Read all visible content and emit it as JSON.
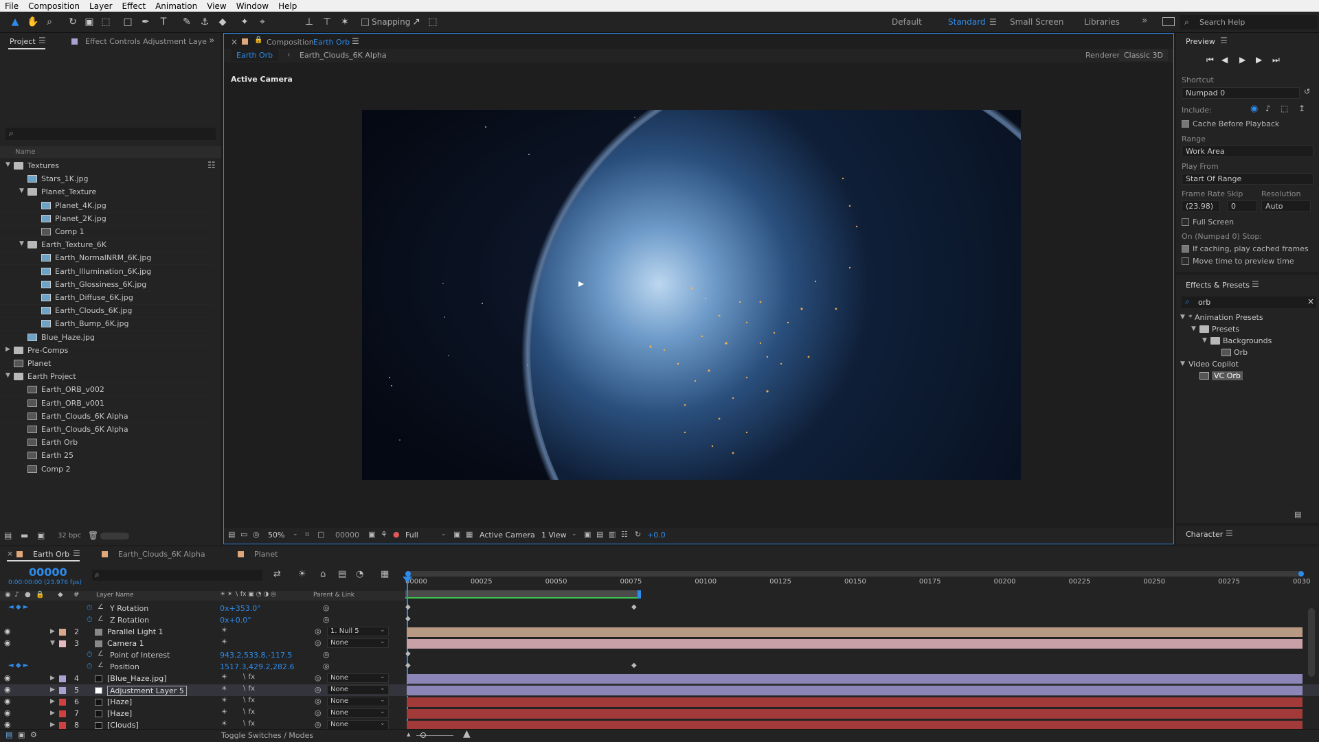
{
  "menu": [
    "File",
    "Composition",
    "Layer",
    "Effect",
    "Animation",
    "View",
    "Window",
    "Help"
  ],
  "toolbar": {
    "snapping": "Snapping"
  },
  "workspaces": {
    "default": "Default",
    "standard": "Standard",
    "small": "Small Screen",
    "libraries": "Libraries",
    "search": "Search Help"
  },
  "project": {
    "tab_label": "Project",
    "effects_tab": "Effect Controls Adjustment Laye",
    "col_name": "Name",
    "bpc": "32 bpc",
    "items": [
      {
        "label": "Textures",
        "type": "folder",
        "level": 0,
        "open": true
      },
      {
        "label": "Stars_1K.jpg",
        "type": "img",
        "level": 1
      },
      {
        "label": "Planet_Texture",
        "type": "folder",
        "level": 1,
        "open": true
      },
      {
        "label": "Planet_4K.jpg",
        "type": "img",
        "level": 2
      },
      {
        "label": "Planet_2K.jpg",
        "type": "img",
        "level": 2
      },
      {
        "label": "Comp 1",
        "type": "comp",
        "level": 2
      },
      {
        "label": "Earth_Texture_6K",
        "type": "folder",
        "level": 1,
        "open": true
      },
      {
        "label": "Earth_NormalNRM_6K.jpg",
        "type": "img",
        "level": 2
      },
      {
        "label": "Earth_Illumination_6K.jpg",
        "type": "img",
        "level": 2
      },
      {
        "label": "Earth_Glossiness_6K.jpg",
        "type": "img",
        "level": 2
      },
      {
        "label": "Earth_Diffuse_6K.jpg",
        "type": "img",
        "level": 2
      },
      {
        "label": "Earth_Clouds_6K.jpg",
        "type": "img",
        "level": 2
      },
      {
        "label": "Earth_Bump_6K.jpg",
        "type": "img",
        "level": 2
      },
      {
        "label": "Blue_Haze.jpg",
        "type": "img",
        "level": 1
      },
      {
        "label": "Pre-Comps",
        "type": "folder",
        "level": 0,
        "open": false
      },
      {
        "label": "Planet",
        "type": "comp",
        "level": 0
      },
      {
        "label": "Earth Project",
        "type": "folder",
        "level": 0,
        "open": true
      },
      {
        "label": "Earth_ORB_v002",
        "type": "comp",
        "level": 1
      },
      {
        "label": "Earth_ORB_v001",
        "type": "comp",
        "level": 1
      },
      {
        "label": "Earth_Clouds_6K Alpha",
        "type": "comp",
        "level": 1
      },
      {
        "label": "Earth_Clouds_6K Alpha",
        "type": "comp",
        "level": 1
      },
      {
        "label": "Earth Orb",
        "type": "comp",
        "level": 1
      },
      {
        "label": "Earth 25",
        "type": "comp",
        "level": 1
      },
      {
        "label": "Comp 2",
        "type": "comp",
        "level": 1
      }
    ]
  },
  "composition": {
    "tab_prefix": "Composition",
    "tab_name": "Earth Orb",
    "crumb1": "Earth Orb",
    "crumb2": "Earth_Clouds_6K Alpha",
    "renderer_label": "Renderer:",
    "renderer": "Classic 3D",
    "camera_label": "Active Camera",
    "zoom": "50%",
    "timecode": "00000",
    "resolution": "Full",
    "view_camera": "Active Camera",
    "views": "1 View",
    "exposure": "+0.0"
  },
  "preview": {
    "title": "Preview",
    "shortcut_label": "Shortcut",
    "shortcut": "Numpad 0",
    "include_label": "Include:",
    "cache_before": "Cache Before Playback",
    "range_label": "Range",
    "range": "Work Area",
    "playfrom_label": "Play From",
    "playfrom": "Start Of Range",
    "framerate_label": "Frame Rate",
    "skip_label": "Skip",
    "resolution_label": "Resolution",
    "framerate": "(23.98)",
    "skip": "0",
    "resolution": "Auto",
    "fullscreen": "Full Screen",
    "stop_label": "On (Numpad 0) Stop:",
    "if_caching": "If caching, play cached frames",
    "move_time": "Move time to preview time"
  },
  "effects": {
    "title": "Effects & Presets",
    "search": "orb",
    "tree": [
      {
        "label": "* Animation Presets",
        "level": 0,
        "type": "group"
      },
      {
        "label": "Presets",
        "level": 1,
        "type": "folder"
      },
      {
        "label": "Backgrounds",
        "level": 2,
        "type": "folder"
      },
      {
        "label": "Orb",
        "level": 3,
        "type": "preset"
      },
      {
        "label": "Video Copilot",
        "level": 0,
        "type": "group"
      },
      {
        "label": "VC Orb",
        "level": 1,
        "type": "preset",
        "selected": true
      }
    ]
  },
  "character": {
    "title": "Character"
  },
  "timeline": {
    "tabs": [
      "Earth Orb",
      "Earth_Clouds_6K Alpha",
      "Planet"
    ],
    "timecode": "00000",
    "fps": "0:00:00:00 (23.976 fps)",
    "col_layer": "Layer Name",
    "col_parent": "Parent & Link",
    "ruler": [
      "00000",
      "00025",
      "00050",
      "00075",
      "00100",
      "00125",
      "00150",
      "00175",
      "00200",
      "00225",
      "00250",
      "00275",
      "0030"
    ],
    "rows": [
      {
        "kind": "prop",
        "name": "Y Rotation",
        "value": "0x+353.0°",
        "key": true
      },
      {
        "kind": "prop",
        "name": "Z Rotation",
        "value": "0x+0.0°",
        "key": false
      },
      {
        "kind": "layer",
        "num": "2",
        "name": "Parallel Light 1",
        "parent": "1. Null 5",
        "color": "#d9a88b",
        "bar": "#b89a84"
      },
      {
        "kind": "layer",
        "num": "3",
        "name": "Camera 1",
        "parent": "None",
        "color": "#e6b9c0",
        "bar": "#c9a0a8",
        "open": true
      },
      {
        "kind": "prop",
        "name": "Point of Interest",
        "value": "943.2,533.8,-117.5",
        "key": false
      },
      {
        "kind": "prop",
        "name": "Position",
        "value": "1517.3,429.2,282.6",
        "key": true
      },
      {
        "kind": "layer",
        "num": "4",
        "name": "[Blue_Haze.jpg]",
        "parent": "None",
        "color": "#a9a2d0",
        "bar": "#8c86b8"
      },
      {
        "kind": "layer",
        "num": "5",
        "name": "Adjustment Layer 5",
        "parent": "None",
        "color": "#a9a2d0",
        "bar": "#8c86b8",
        "selected": true
      },
      {
        "kind": "layer",
        "num": "6",
        "name": "[Haze]",
        "parent": "None",
        "color": "#d0403e",
        "bar": "#a23a3a"
      },
      {
        "kind": "layer",
        "num": "7",
        "name": "[Haze]",
        "parent": "None",
        "color": "#d0403e",
        "bar": "#a23a3a"
      },
      {
        "kind": "layer",
        "num": "8",
        "name": "[Clouds]",
        "parent": "None",
        "color": "#d0403e",
        "bar": "#a23a3a"
      }
    ],
    "toggle": "Toggle Switches / Modes"
  }
}
